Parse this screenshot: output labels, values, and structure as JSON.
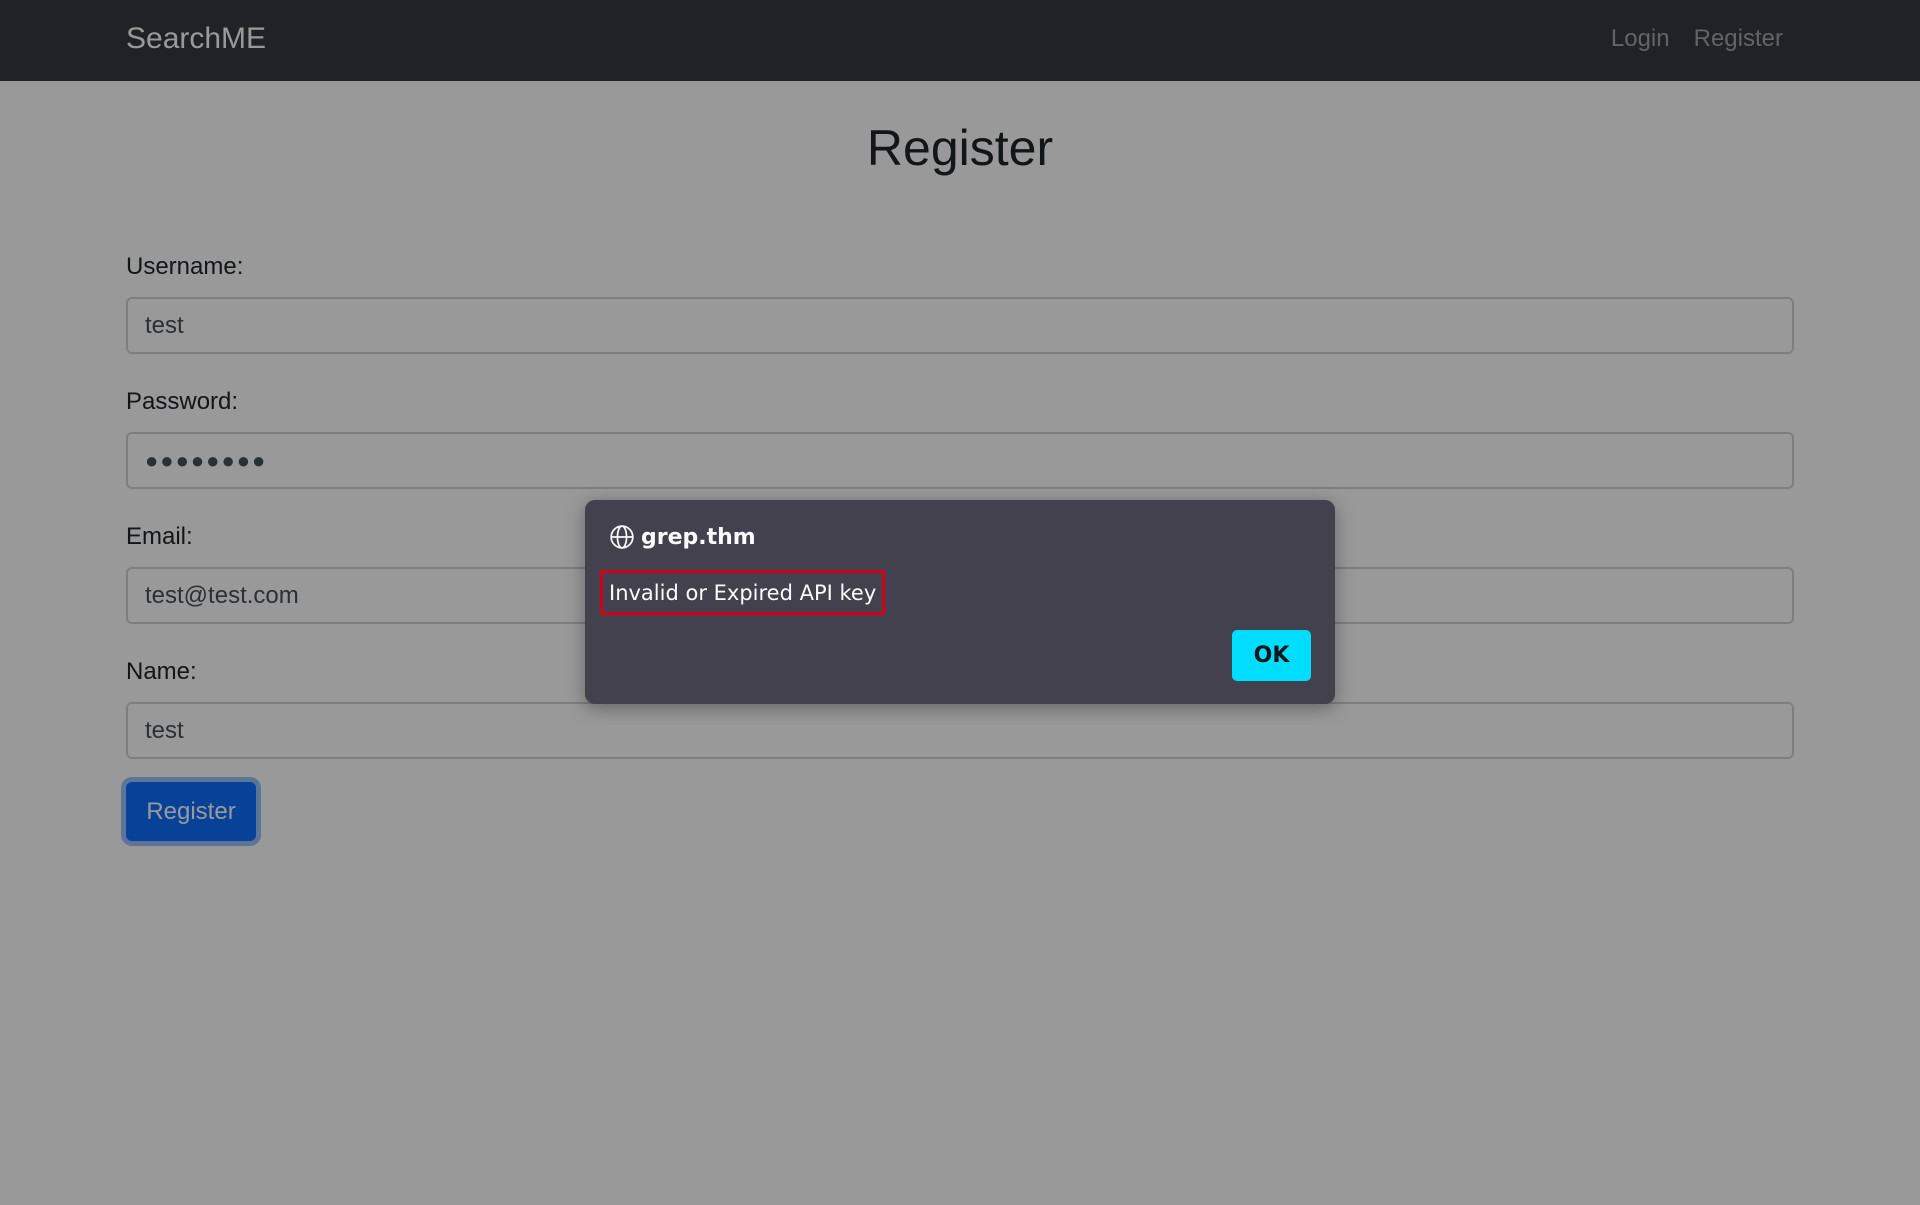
{
  "navbar": {
    "brand": "SearchME",
    "links": [
      "Login",
      "Register"
    ]
  },
  "page": {
    "title": "Register"
  },
  "form": {
    "username": {
      "label": "Username:",
      "value": "test"
    },
    "password": {
      "label": "Password:",
      "value": "●●●●●●●●"
    },
    "email": {
      "label": "Email:",
      "value": "test@test.com"
    },
    "name": {
      "label": "Name:",
      "value": "test"
    },
    "submit_label": "Register"
  },
  "dialog": {
    "icon": "globe-icon",
    "origin": "grep.thm",
    "message": "Invalid or Expired API key",
    "ok_label": "OK"
  },
  "colors": {
    "navbar": "#343a40",
    "primary": "#0d6efd",
    "dialog_bg": "#42414d",
    "ok_button": "#00ddff",
    "highlight_border": "#d0011b"
  }
}
